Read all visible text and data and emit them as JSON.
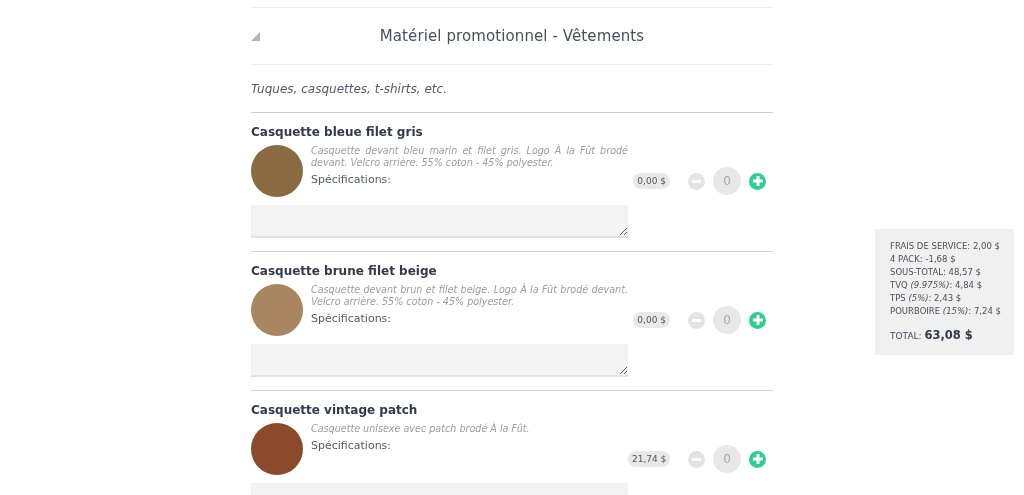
{
  "section": {
    "title": "Matériel promotionnel - Vêtements",
    "expanded": true,
    "subtitle": "Tuques, casquettes, t-shirts, etc."
  },
  "items": [
    {
      "name": "Casquette bleue filet gris",
      "description": "Casquette devant bleu marin et filet gris. Logo À la Fût brodé devant. Velcro arrière. 55% coton - 45% polyester.",
      "spec_label": "Spécifications:",
      "price": "0,00 $",
      "quantity": "0"
    },
    {
      "name": "Casquette brune filet beige",
      "description": "Casquette devant brun et filet beige. Logo À la Fût brodé devant. Velcro arrière. 55% coton - 45% polyester.",
      "spec_label": "Spécifications:",
      "price": "0,00 $",
      "quantity": "0"
    },
    {
      "name": "Casquette vintage patch",
      "description": "Casquette unisexe avec patch brodé À la Fût.",
      "spec_label": "Spécifications:",
      "price": "21,74 $",
      "quantity": "0"
    }
  ],
  "summary": {
    "lines": [
      "FRAIS DE SERVICE: 2,00 $",
      "4 PACK: -1,68 $",
      "SOUS-TOTAL: 48,57 $",
      "TVQ *(9.975%)*: 4,84 $",
      "TPS *(5%)*: 2,43 $",
      "POURBOIRE *(15%)*: 7,24 $"
    ],
    "total": "TOTAL: **63,08 $**"
  }
}
